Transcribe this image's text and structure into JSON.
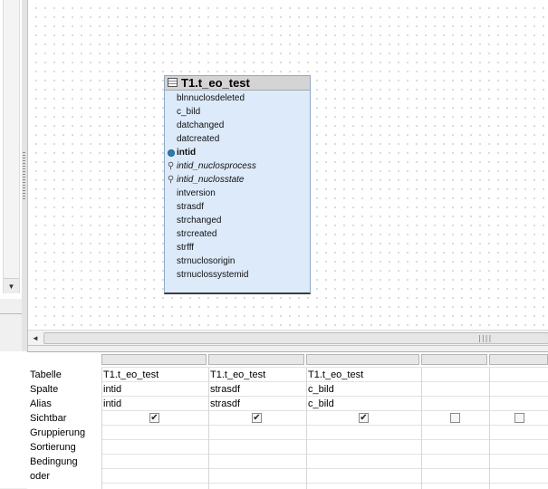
{
  "diagram": {
    "table": {
      "title": "T1.t_eo_test",
      "fields": [
        {
          "name": "blnnuclosdeleted",
          "kind": "plain"
        },
        {
          "name": "c_bild",
          "kind": "plain"
        },
        {
          "name": "datchanged",
          "kind": "plain"
        },
        {
          "name": "datcreated",
          "kind": "plain"
        },
        {
          "name": "intid",
          "kind": "primary-key"
        },
        {
          "name": "intid_nuclosprocess",
          "kind": "foreign-key"
        },
        {
          "name": "intid_nuclosstate",
          "kind": "foreign-key"
        },
        {
          "name": "intversion",
          "kind": "plain"
        },
        {
          "name": "strasdf",
          "kind": "plain"
        },
        {
          "name": "strchanged",
          "kind": "plain"
        },
        {
          "name": "strcreated",
          "kind": "plain"
        },
        {
          "name": "strfff",
          "kind": "plain"
        },
        {
          "name": "strnuclosorigin",
          "kind": "plain"
        },
        {
          "name": "strnuclossystemid",
          "kind": "plain"
        }
      ]
    }
  },
  "icons": {
    "table": "table-grid-icon",
    "primary_key": "primary-key-dot-icon",
    "foreign_key": "link-chain-icon",
    "scroll_down": "arrow-down-icon",
    "scroll_left": "arrow-left-icon",
    "check": "checkmark-icon"
  },
  "glyphs": {
    "scroll_down": "▼",
    "scroll_left": "◄",
    "scroll_grip": "||||",
    "foreign_key": "⚲",
    "check": "✔"
  },
  "colors": {
    "table_body": "#dceafa",
    "table_header": "#d4d4d4",
    "primary_key": "#2a7fb0",
    "canvas": "#ffffff"
  },
  "grid": {
    "row_labels": [
      "Tabelle",
      "Spalte",
      "Alias",
      "Sichtbar",
      "Gruppierung",
      "Sortierung",
      "Bedingung",
      "oder"
    ],
    "columns": [
      {
        "tabelle": "T1.t_eo_test",
        "spalte": "intid",
        "alias": "intid",
        "sichtbar": true
      },
      {
        "tabelle": "T1.t_eo_test",
        "spalte": "strasdf",
        "alias": "strasdf",
        "sichtbar": true
      },
      {
        "tabelle": "T1.t_eo_test",
        "spalte": "c_bild",
        "alias": "c_bild",
        "sichtbar": true
      },
      {
        "tabelle": "",
        "spalte": "",
        "alias": "",
        "sichtbar": false
      },
      {
        "tabelle": "",
        "spalte": "",
        "alias": "",
        "sichtbar": false
      }
    ]
  }
}
